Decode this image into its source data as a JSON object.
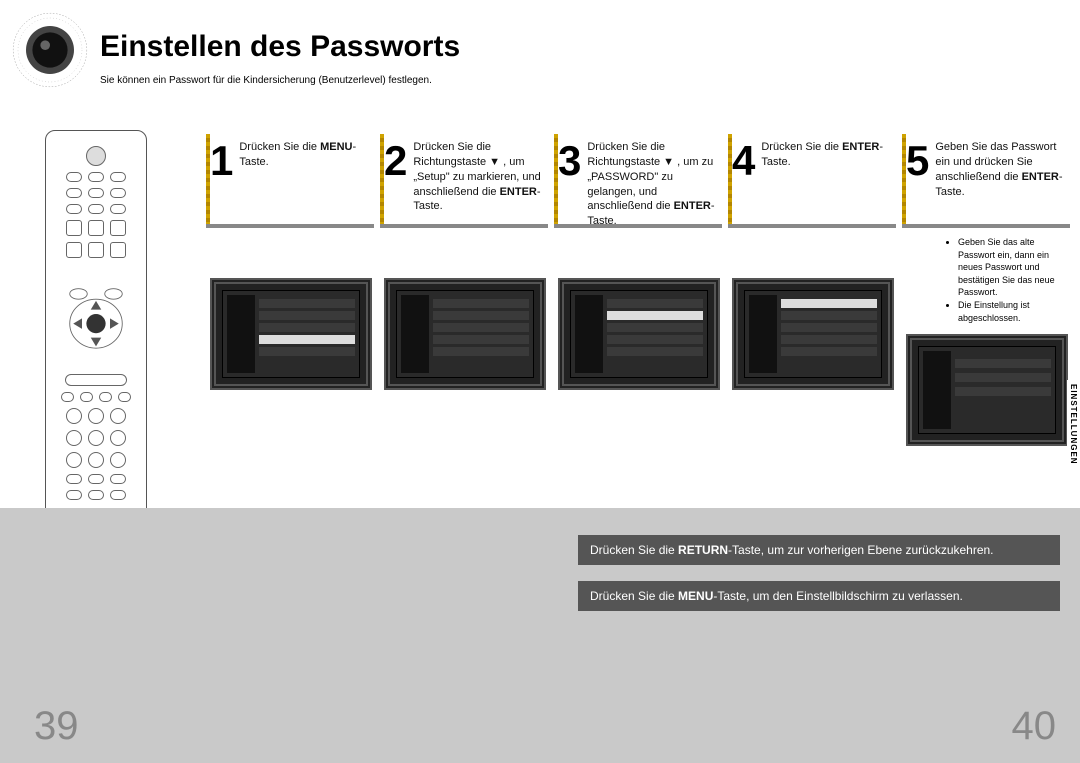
{
  "title": "Einstellen des Passworts",
  "subtitle": "Sie können ein Passwort für die Kindersicherung (Benutzerlevel) festlegen.",
  "side_tab": "EINSTELLUNGEN",
  "pages": {
    "left": "39",
    "right": "40"
  },
  "steps": [
    {
      "num": "1",
      "html": "Drücken Sie die <b>MENU</b>-Taste."
    },
    {
      "num": "2",
      "html": "Drücken Sie die Richtungstaste ▼ , um „Setup\" zu markieren, und anschließend die <b>ENTER</b>-Taste."
    },
    {
      "num": "3",
      "html": "Drücken Sie die Richtungstaste ▼ , um zu „PASSWORD\" zu gelangen, und anschließend die <b>ENTER</b>-Taste."
    },
    {
      "num": "4",
      "html": "Drücken Sie die <b>ENTER</b>-Taste."
    },
    {
      "num": "5",
      "html": "Geben Sie das Passwort ein und drücken Sie anschließend die <b>ENTER</b>-Taste."
    }
  ],
  "step5_notes": [
    "Geben Sie das alte Passwort ein, dann ein neues Passwort und bestätigen Sie das neue Passwort.",
    "Die Einstellung ist abgeschlossen."
  ],
  "tips": [
    "Drücken Sie die <b>RETURN</b>-Taste, um zur vorherigen Ebene zurückzukehren.",
    "Drücken Sie die <b>MENU</b>-Taste, um den Einstellbildschirm zu verlassen."
  ]
}
